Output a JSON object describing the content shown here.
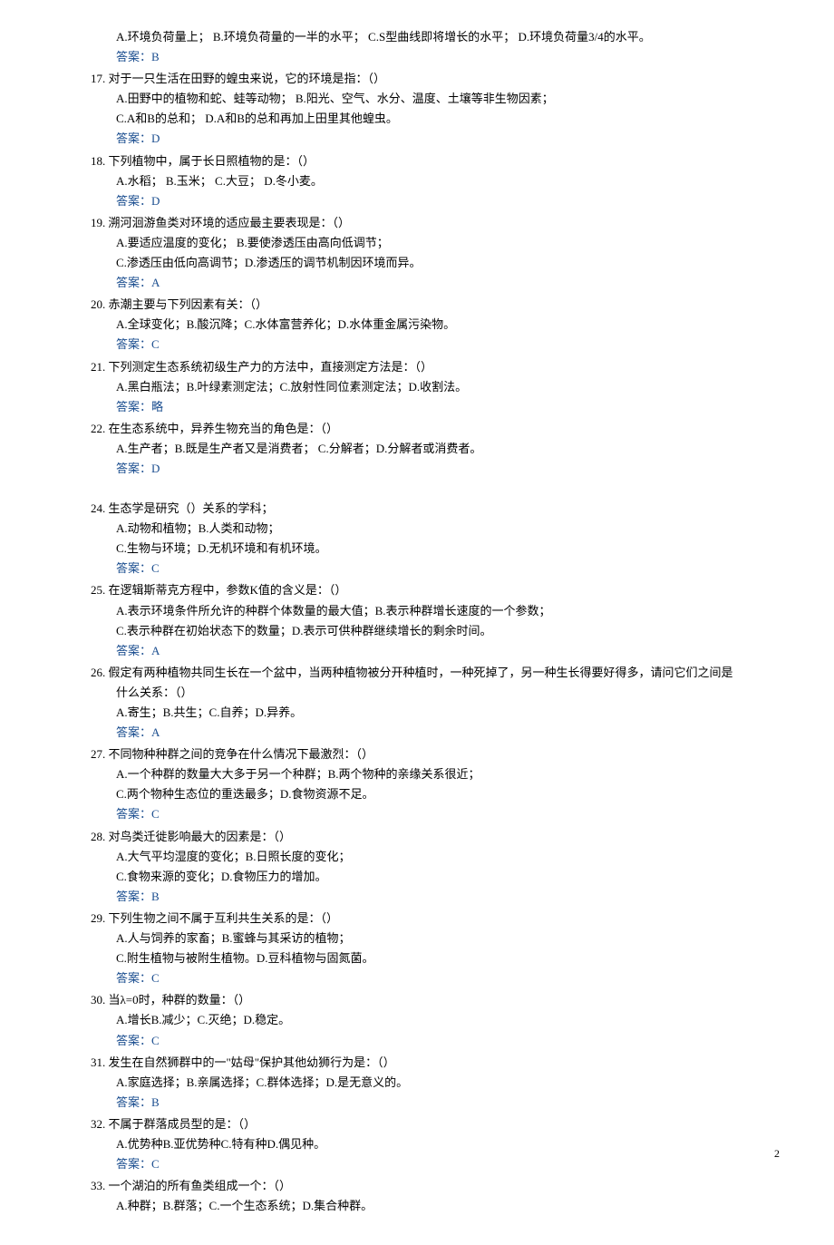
{
  "questions": [
    {
      "num": "",
      "stem": "",
      "options": "A.环境负荷量上；  B.环境负荷量的一半的水平；  C.S型曲线即将增长的水平；  D.环境负荷量3/4的水平。",
      "answer": "答案：B",
      "noStem": true
    },
    {
      "num": "17.",
      "stem": "对于一只生活在田野的蝗虫来说，它的环境是指：（）",
      "optionsLines": [
        "A.田野中的植物和蛇、蛙等动物；         B.阳光、空气、水分、温度、土壤等非生物因素；",
        "C.A和B的总和；            D.A和B的总和再加上田里其他蝗虫。"
      ],
      "answer": "答案：D"
    },
    {
      "num": "18.",
      "stem": "下列植物中，属于长日照植物的是：（）",
      "options": "A.水稻；   B.玉米；  C.大豆；  D.冬小麦。",
      "answer": "答案：D"
    },
    {
      "num": "19.",
      "stem": "溯河洄游鱼类对环境的适应最主要表现是：（）",
      "optionsLines": [
        "A.要适应温度的变化；    B.要使渗透压由高向低调节；",
        "C.渗透压由低向高调节；D.渗透压的调节机制因环境而异。"
      ],
      "answer": "答案：A"
    },
    {
      "num": "20.",
      "stem": "赤潮主要与下列因素有关：（）",
      "options": "A.全球变化；B.酸沉降；C.水体富营养化；D.水体重金属污染物。",
      "answer": "答案：C"
    },
    {
      "num": "21.",
      "stem": "下列测定生态系统初级生产力的方法中，直接测定方法是：（）",
      "options": "A.黑白瓶法；B.叶绿素测定法；C.放射性同位素测定法；D.收割法。",
      "answer": "答案：略"
    },
    {
      "num": "22.",
      "stem": "在生态系统中，异养生物充当的角色是：（）",
      "options": "A.生产者；B.既是生产者又是消费者；   C.分解者；D.分解者或消费者。",
      "answer": "答案：D",
      "gapAfter": true
    },
    {
      "num": "24.",
      "stem": "生态学是研究（）关系的学科；",
      "optionsLines": [
        "A.动物和植物；B.人类和动物；",
        "C.生物与环境；D.无机环境和有机环境。"
      ],
      "answer": "答案：C"
    },
    {
      "num": "25.",
      "stem": "在逻辑斯蒂克方程中，参数K值的含义是：（）",
      "optionsLines": [
        "A.表示环境条件所允许的种群个体数量的最大值；B.表示种群增长速度的一个参数；",
        "C.表示种群在初始状态下的数量；D.表示可供种群继续增长的剩余时间。"
      ],
      "answer": "答案：A"
    },
    {
      "num": "26.",
      "stem": "假定有两种植物共同生长在一个盆中，当两种植物被分开种植时，一种死掉了，另一种生长得要好得多，请问它们之间是什么关系：（）",
      "stemWrap": true,
      "options": "A.寄生；B.共生；C.自养；D.异养。",
      "answer": "答案：A"
    },
    {
      "num": "27.",
      "stem": "不同物种种群之间的竞争在什么情况下最激烈：（）",
      "optionsLines": [
        "A.一个种群的数量大大多于另一个种群；B.两个物种的亲缘关系很近；",
        "C.两个物种生态位的重迭最多；D.食物资源不足。"
      ],
      "answer": "答案：C"
    },
    {
      "num": "28.",
      "stem": "对鸟类迁徙影响最大的因素是：（）",
      "optionsLines": [
        "A.大气平均湿度的变化；B.日照长度的变化；",
        "C.食物来源的变化；D.食物压力的增加。"
      ],
      "answer": "答案：B"
    },
    {
      "num": "29.",
      "stem": "下列生物之间不属于互利共生关系的是：（）",
      "optionsLines": [
        "A.人与饲养的家畜；B.蜜蜂与其采访的植物；",
        "C.附生植物与被附生植物。D.豆科植物与固氮菌。"
      ],
      "answer": "答案：C"
    },
    {
      "num": "30.",
      "stem": "当λ=0时，种群的数量：（）",
      "options": "A.增长B.减少；C.灭绝；D.稳定。",
      "answer": "答案：C"
    },
    {
      "num": "31.",
      "stem": "发生在自然狮群中的一\"姑母\"保护其他幼狮行为是：（）",
      "options": "A.家庭选择；B.亲属选择；C.群体选择；D.是无意义的。",
      "answer": "答案：B"
    },
    {
      "num": "32.",
      "stem": "不属于群落成员型的是：（）",
      "options": "A.优势种B.亚优势种C.特有种D.偶见种。",
      "answer": "答案：C"
    },
    {
      "num": "33.",
      "stem": "一个湖泊的所有鱼类组成一个：（）",
      "options": "A.种群；B.群落；C.一个生态系统；D.集合种群。",
      "noAnswer": true
    }
  ],
  "pageNum": "2"
}
